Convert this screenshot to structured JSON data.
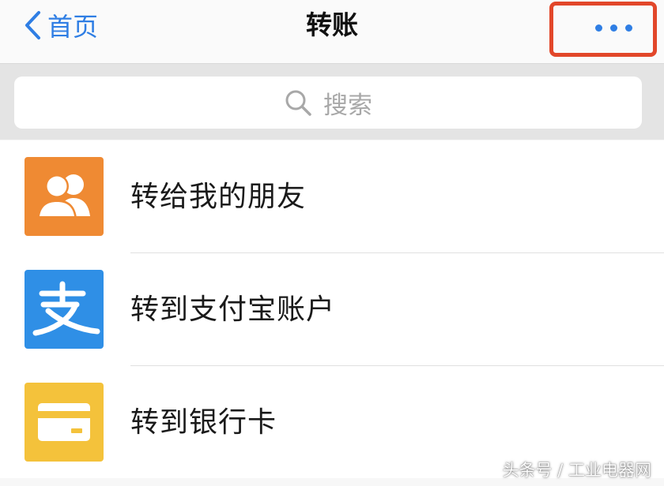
{
  "nav": {
    "back_label": "首页",
    "title": "转账",
    "more_icon": "more-dots-icon",
    "accent_color": "#2f7ee4",
    "highlight_color": "#e2472a"
  },
  "search": {
    "placeholder": "搜索",
    "icon": "search-icon"
  },
  "options": [
    {
      "label": "转给我的朋友",
      "icon": "friends-icon",
      "icon_color": "#ef8a33"
    },
    {
      "label": "转到支付宝账户",
      "icon": "alipay-icon",
      "icon_color": "#2f8fe6"
    },
    {
      "label": "转到银行卡",
      "icon": "bank-card-icon",
      "icon_color": "#f4c23b"
    }
  ],
  "watermark": "头条号 / 工业电器网"
}
